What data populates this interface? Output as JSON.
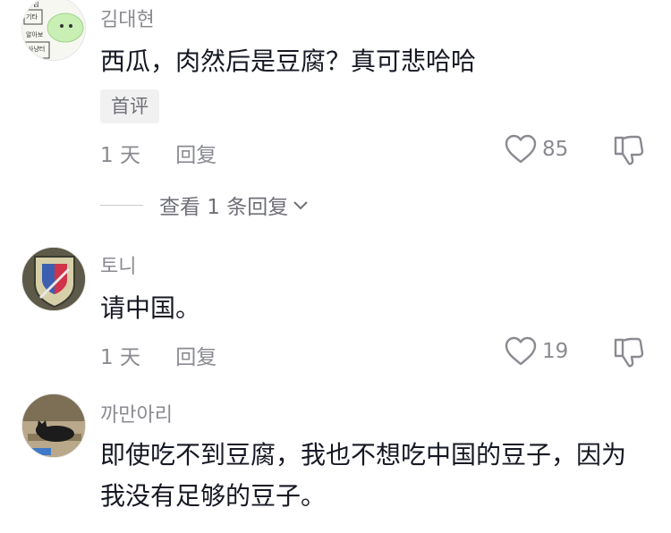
{
  "comments": [
    {
      "username": "김대현",
      "text": "西瓜，肉然后是豆腐？真可悲哈哈",
      "badge": "首评",
      "time": "1 天",
      "reply_label": "回复",
      "likes": "85",
      "view_replies": "查看 1 条回复",
      "avatar_text": [
        "관심",
        "기타",
        "알아보",
        "사냥터"
      ]
    },
    {
      "username": "토니",
      "text": "请中国。",
      "time": "1 天",
      "reply_label": "回复",
      "likes": "19"
    },
    {
      "username": "까만아리",
      "text": "即使吃不到豆腐，我也不想吃中国的豆子，因为我没有足够的豆子。"
    }
  ],
  "colors": {
    "secondary_text": "#8a8b91",
    "primary_text": "#161823",
    "badge_bg": "#f1f1f2"
  }
}
